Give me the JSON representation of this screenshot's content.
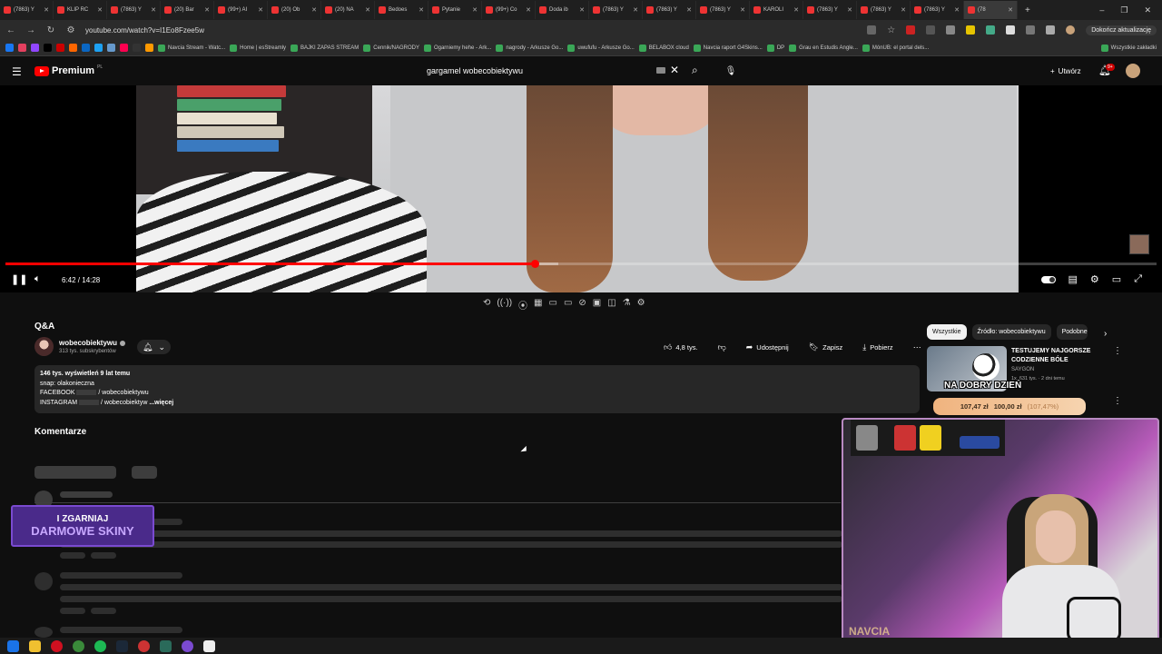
{
  "browser": {
    "tabs": [
      {
        "label": "(7863) Y"
      },
      {
        "label": "KLIP RC"
      },
      {
        "label": "(7863) Y"
      },
      {
        "label": "(20) Bar"
      },
      {
        "label": "(99+) AI"
      },
      {
        "label": "(20) Ob"
      },
      {
        "label": "(20) NA"
      },
      {
        "label": "Bedoes"
      },
      {
        "label": "Pytanie"
      },
      {
        "label": "(99+) Co"
      },
      {
        "label": "Doda ib"
      },
      {
        "label": "(7863) Y"
      },
      {
        "label": "(7863) Y"
      },
      {
        "label": "(7863) Y"
      },
      {
        "label": "KAROLI"
      },
      {
        "label": "(7863) Y"
      },
      {
        "label": "(7863) Y"
      },
      {
        "label": "(7863) Y"
      },
      {
        "label": "(78"
      }
    ],
    "url": "youtube.com/watch?v=I1Eo8Fzee5w",
    "update_label": "Dokończ aktualizację",
    "bookmarks": [
      "Navcia Stream - Watc...",
      "Home | esStreamly",
      "BAJKI ZAPAS STREAM",
      "Cennik/NAGRODY",
      "Ogarniemy hehe - Ark...",
      "nagrody - Arkusze Go...",
      "uwufufu - Arkusze Go...",
      "BELABOX cloud",
      "Navcia raport G4Skins...",
      "DP",
      "Grau en Estudis Angle...",
      "MónUB: el portal dels...",
      "Wszystkie zakładki"
    ]
  },
  "youtube": {
    "logo_text": "Premium",
    "logo_region": "PL",
    "search_value": "gargamel wobecobiektywu",
    "create_label": "Utwórz",
    "notif_count": "9+"
  },
  "player": {
    "time": "6:42 / 14:28",
    "progress": 0.46,
    "buffered": 0.48
  },
  "extension_toolbar": [
    "⟲",
    "((·))",
    "⦿",
    "▦",
    "▭",
    "▭",
    "⊘",
    "▣",
    "◫",
    "⚗",
    "⚙"
  ],
  "video": {
    "title": "Q&A",
    "channel": "wobecobiektywu",
    "subscribers": "313 tys. subskrybentów",
    "likes": "4,8 tys.",
    "share_label": "Udostępnij",
    "save_label": "Zapisz",
    "download_label": "Pobierz"
  },
  "description": {
    "stats": "146 tys. wyświetleń  9 lat temu",
    "line1": "snap: olakonieczna",
    "facebook_label": "FACEBOOK",
    "facebook_value": "/ wobecobiektywu",
    "instagram_label": "INSTAGRAM",
    "instagram_value": "/ wobecobiektyw",
    "more_label": "...więcej"
  },
  "comments": {
    "title": "Komentarze"
  },
  "sidebar": {
    "chips": [
      "Wszystkie",
      "Źródło: wobecobiektywu",
      "Podobne"
    ],
    "rec": {
      "title": "TESTUJEMY NAJGORSZE CODZIENNE BÓLE",
      "channel": "SAYGON",
      "meta": "1x, 631 tys. · 2 dni temu"
    }
  },
  "stream_overlay": {
    "headline": "NA DOBRY DZIEŃ",
    "donation_current": "107,47 zł",
    "donation_goal": "100,00 zł",
    "donation_pct": "(107,47%)",
    "promo_line1": "I ZGARNIAJ",
    "promo_line2": "DARMOWE SKINY",
    "cam_watermark": "NAVCIA"
  }
}
